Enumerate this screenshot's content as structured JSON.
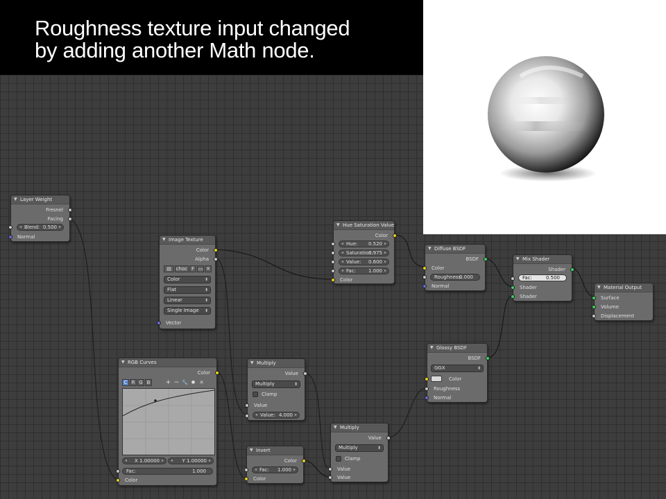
{
  "caption": {
    "line1": "Roughness texture input changed",
    "line2": "by adding another Math node."
  },
  "nodes": {
    "layer_weight": {
      "title": "Layer Weight",
      "out_fresnel": "Fresnel",
      "out_facing": "Facing",
      "blend_label": "Blend:",
      "blend_value": "0.500",
      "in_normal": "Normal"
    },
    "image_texture": {
      "title": "Image Texture",
      "out_color": "Color",
      "out_alpha": "Alpha",
      "image_name": "choc",
      "fake_user": "F",
      "color_space": "Color",
      "projection": "Flat",
      "interpolation": "Linear",
      "source": "Single Image",
      "in_vector": "Vector"
    },
    "hue_sat": {
      "title": "Hue Saturation Value",
      "out_color": "Color",
      "hue_label": "Hue:",
      "hue_value": "0.520",
      "sat_label": "Saturation:",
      "sat_value": "0.975",
      "val_label": "Value:",
      "val_value": "0.600",
      "fac_label": "Fac:",
      "fac_value": "1.000",
      "in_color": "Color"
    },
    "diffuse": {
      "title": "Diffuse BSDF",
      "out_bsdf": "BSDF",
      "in_color": "Color",
      "rough_label": "Roughness:",
      "rough_value": "0.000",
      "in_normal": "Normal"
    },
    "mix_shader": {
      "title": "Mix Shader",
      "out_shader": "Shader",
      "fac_label": "Fac:",
      "fac_value": "0.500",
      "in_shader1": "Shader",
      "in_shader2": "Shader"
    },
    "material_output": {
      "title": "Material Output",
      "in_surface": "Surface",
      "in_volume": "Volume",
      "in_displacement": "Displacement"
    },
    "rgb_curves": {
      "title": "RGB Curves",
      "out_color": "Color",
      "btn_c": "C",
      "btn_r": "R",
      "btn_g": "G",
      "btn_b": "B",
      "tool_plus": "+",
      "tool_minus": "−",
      "tool_wrench": "🔧",
      "tool_dot": "●",
      "tool_x": "✕",
      "x_field": "X 1.00000",
      "y_field": "Y 1.00000",
      "fac_label": "Fac:",
      "fac_value": "1.000",
      "in_color": "Color"
    },
    "multiply1": {
      "title": "Multiply",
      "out_value": "Value",
      "operation": "Multiply",
      "clamp_label": "Clamp",
      "in_value": "Value",
      "value_label": "Value:",
      "value_value": "4.000"
    },
    "invert": {
      "title": "Invert",
      "out_color": "Color",
      "fac_label": "Fac:",
      "fac_value": "1.000",
      "in_color": "Color"
    },
    "multiply2": {
      "title": "Multiply",
      "out_value": "Value",
      "operation": "Multiply",
      "clamp_label": "Clamp",
      "in_value1": "Value",
      "in_value2": "Value"
    },
    "glossy": {
      "title": "Glossy BSDF",
      "out_bsdf": "BSDF",
      "distribution": "GGX",
      "in_color": "Color",
      "in_roughness": "Roughness",
      "in_normal": "Normal"
    }
  },
  "colors": {
    "socket_color": "#e5d31c",
    "socket_value": "#c7c7c7",
    "socket_shader": "#3fd05c",
    "socket_vector": "#6a6ad8",
    "node_body": "#6b6b6b",
    "editor_bg": "#3d3d3d"
  },
  "icons": {
    "collapse": "triangle-down-icon",
    "dropdown": "updown-arrow-icon",
    "image_browse": "image-browse-icon",
    "folder": "folder-icon",
    "unlink": "x-icon"
  }
}
